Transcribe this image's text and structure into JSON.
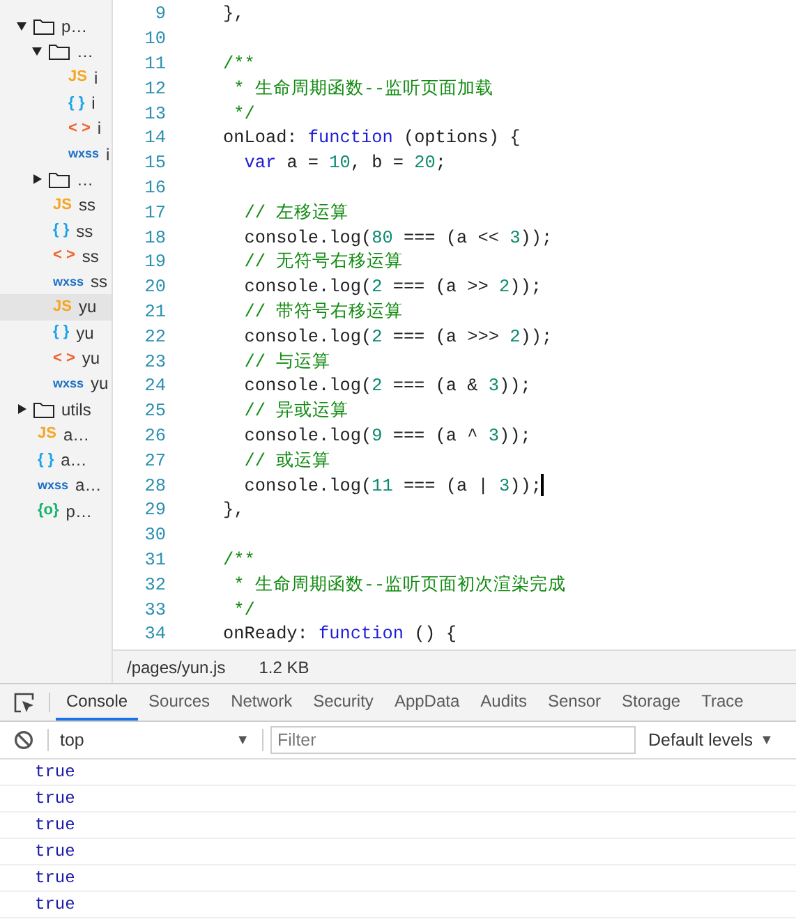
{
  "file_tree": [
    {
      "kind": "folder",
      "name": "p…",
      "expanded": true,
      "selected": false,
      "children": [
        {
          "kind": "folder",
          "name": "…",
          "expanded": true,
          "selected": false,
          "children": [
            {
              "kind": "js",
              "badge": "JS",
              "name": "i",
              "selected": false
            },
            {
              "kind": "json",
              "badge": "{ }",
              "name": "i",
              "selected": false
            },
            {
              "kind": "wxml",
              "badge": "< >",
              "name": "i",
              "selected": false
            },
            {
              "kind": "wxss",
              "badge": "wxss",
              "name": "i",
              "selected": false
            }
          ]
        },
        {
          "kind": "folder",
          "name": "…",
          "expanded": false,
          "selected": false
        },
        {
          "kind": "js",
          "badge": "JS",
          "name": "ss",
          "selected": false
        },
        {
          "kind": "json",
          "badge": "{ }",
          "name": "ss",
          "selected": false
        },
        {
          "kind": "wxml",
          "badge": "< >",
          "name": "ss",
          "selected": false
        },
        {
          "kind": "wxss",
          "badge": "wxss",
          "name": "ss",
          "selected": false
        },
        {
          "kind": "js",
          "badge": "JS",
          "name": "yu",
          "selected": true
        },
        {
          "kind": "json",
          "badge": "{ }",
          "name": "yu",
          "selected": false
        },
        {
          "kind": "wxml",
          "badge": "< >",
          "name": "yu",
          "selected": false
        },
        {
          "kind": "wxss",
          "badge": "wxss",
          "name": "yu",
          "selected": false
        }
      ]
    },
    {
      "kind": "folder",
      "name": "utils",
      "expanded": false,
      "selected": false
    },
    {
      "kind": "js",
      "badge": "JS",
      "name": "a…",
      "selected": false
    },
    {
      "kind": "json",
      "badge": "{ }",
      "name": "a…",
      "selected": false
    },
    {
      "kind": "wxss",
      "badge": "wxss",
      "name": "a…",
      "selected": false
    },
    {
      "kind": "config",
      "badge": "{o}",
      "name": "p…",
      "selected": false
    }
  ],
  "editor": {
    "lines": [
      {
        "number": "9",
        "tokens": [
          {
            "kind": "plain",
            "text": "},"
          }
        ]
      },
      {
        "number": "10"
      },
      {
        "number": "11",
        "tokens": [
          {
            "kind": "comment",
            "text": "/**"
          }
        ]
      },
      {
        "number": "12",
        "tokens": [
          {
            "kind": "comment",
            "text": " * 生命周期函数--监听页面加载"
          }
        ]
      },
      {
        "number": "13",
        "tokens": [
          {
            "kind": "comment",
            "text": " */"
          }
        ]
      },
      {
        "number": "14",
        "tokens": [
          {
            "kind": "plain",
            "text": "onLoad: "
          },
          {
            "kind": "keyword",
            "text": "function"
          },
          {
            "kind": "plain",
            "text": " (options) {"
          }
        ]
      },
      {
        "number": "15",
        "tokens": [
          {
            "kind": "keyword",
            "text": "  var"
          },
          {
            "kind": "plain",
            "text": " a = "
          },
          {
            "kind": "number",
            "text": "10"
          },
          {
            "kind": "plain",
            "text": ", b = "
          },
          {
            "kind": "number",
            "text": "20"
          },
          {
            "kind": "plain",
            "text": ";"
          }
        ]
      },
      {
        "number": "16"
      },
      {
        "number": "17",
        "tokens": [
          {
            "kind": "comment",
            "text": "  // 左移运算"
          }
        ]
      },
      {
        "number": "18",
        "tokens": [
          {
            "kind": "plain",
            "text": "  console.log("
          },
          {
            "kind": "number",
            "text": "80"
          },
          {
            "kind": "plain",
            "text": " === (a << "
          },
          {
            "kind": "number",
            "text": "3"
          },
          {
            "kind": "plain",
            "text": "));"
          }
        ]
      },
      {
        "number": "19",
        "tokens": [
          {
            "kind": "comment",
            "text": "  // 无符号右移运算"
          }
        ]
      },
      {
        "number": "20",
        "tokens": [
          {
            "kind": "plain",
            "text": "  console.log("
          },
          {
            "kind": "number",
            "text": "2"
          },
          {
            "kind": "plain",
            "text": " === (a >> "
          },
          {
            "kind": "number",
            "text": "2"
          },
          {
            "kind": "plain",
            "text": "));"
          }
        ]
      },
      {
        "number": "21",
        "tokens": [
          {
            "kind": "comment",
            "text": "  // 带符号右移运算"
          }
        ]
      },
      {
        "number": "22",
        "tokens": [
          {
            "kind": "plain",
            "text": "  console.log("
          },
          {
            "kind": "number",
            "text": "2"
          },
          {
            "kind": "plain",
            "text": " === (a >>> "
          },
          {
            "kind": "number",
            "text": "2"
          },
          {
            "kind": "plain",
            "text": "));"
          }
        ]
      },
      {
        "number": "23",
        "tokens": [
          {
            "kind": "comment",
            "text": "  // 与运算"
          }
        ]
      },
      {
        "number": "24",
        "tokens": [
          {
            "kind": "plain",
            "text": "  console.log("
          },
          {
            "kind": "number",
            "text": "2"
          },
          {
            "kind": "plain",
            "text": " === (a & "
          },
          {
            "kind": "number",
            "text": "3"
          },
          {
            "kind": "plain",
            "text": "));"
          }
        ]
      },
      {
        "number": "25",
        "tokens": [
          {
            "kind": "comment",
            "text": "  // 异或运算"
          }
        ]
      },
      {
        "number": "26",
        "tokens": [
          {
            "kind": "plain",
            "text": "  console.log("
          },
          {
            "kind": "number",
            "text": "9"
          },
          {
            "kind": "plain",
            "text": " === (a ^ "
          },
          {
            "kind": "number",
            "text": "3"
          },
          {
            "kind": "plain",
            "text": "));"
          }
        ]
      },
      {
        "number": "27",
        "tokens": [
          {
            "kind": "comment",
            "text": "  // 或运算"
          }
        ]
      },
      {
        "number": "28",
        "cursor": true,
        "tokens": [
          {
            "kind": "plain",
            "text": "  console.log("
          },
          {
            "kind": "number",
            "text": "11"
          },
          {
            "kind": "plain",
            "text": " === (a | "
          },
          {
            "kind": "number",
            "text": "3"
          },
          {
            "kind": "plain",
            "text": "));"
          }
        ]
      },
      {
        "number": "29",
        "tokens": [
          {
            "kind": "plain",
            "text": "},"
          }
        ]
      },
      {
        "number": "30"
      },
      {
        "number": "31",
        "tokens": [
          {
            "kind": "comment",
            "text": "/**"
          }
        ]
      },
      {
        "number": "32",
        "tokens": [
          {
            "kind": "comment",
            "text": " * 生命周期函数--监听页面初次渲染完成"
          }
        ]
      },
      {
        "number": "33",
        "tokens": [
          {
            "kind": "comment",
            "text": " */"
          }
        ]
      },
      {
        "number": "34",
        "tokens": [
          {
            "kind": "plain",
            "text": "onReady: "
          },
          {
            "kind": "keyword",
            "text": "function"
          },
          {
            "kind": "plain",
            "text": " () {"
          }
        ]
      }
    ]
  },
  "status_bar": {
    "path": "/pages/yun.js",
    "size": "1.2 KB"
  },
  "devtools": {
    "tabs": [
      {
        "label": "Console",
        "selected": true
      },
      {
        "label": "Sources",
        "selected": false
      },
      {
        "label": "Network",
        "selected": false
      },
      {
        "label": "Security",
        "selected": false
      },
      {
        "label": "AppData",
        "selected": false
      },
      {
        "label": "Audits",
        "selected": false
      },
      {
        "label": "Sensor",
        "selected": false
      },
      {
        "label": "Storage",
        "selected": false
      },
      {
        "label": "Trace",
        "selected": false
      }
    ],
    "context_select": {
      "value": "top",
      "caret": "▼"
    },
    "filter": {
      "placeholder": "Filter"
    },
    "levels": {
      "label": "Default levels",
      "caret": "▼"
    },
    "messages": [
      "true",
      "true",
      "true",
      "true",
      "true",
      "true"
    ]
  }
}
